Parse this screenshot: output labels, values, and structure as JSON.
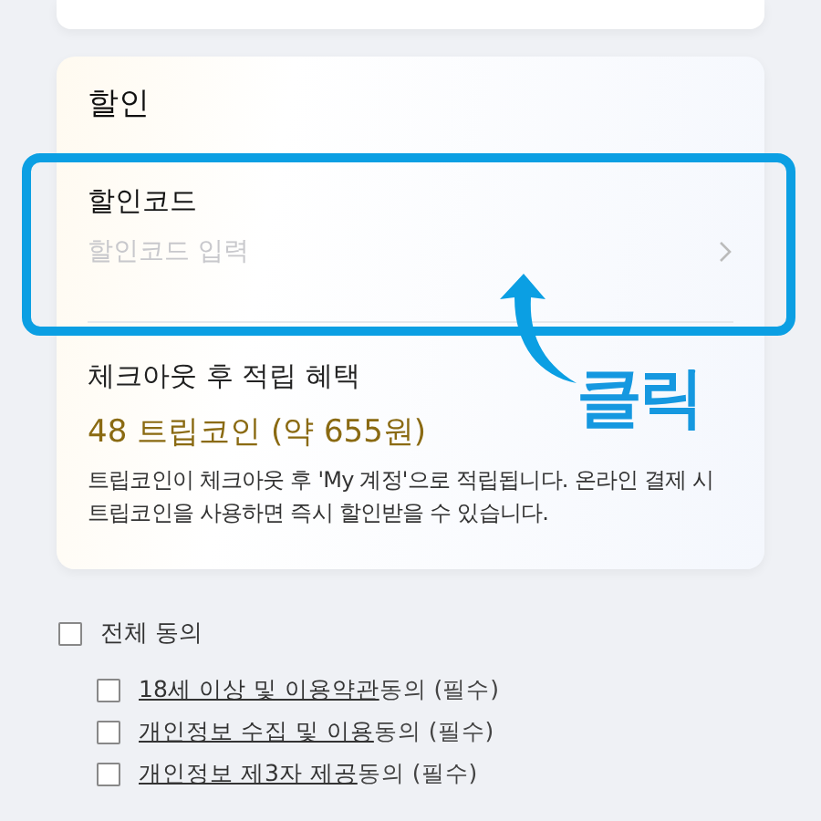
{
  "discount": {
    "title": "할인",
    "code_label": "할인코드",
    "code_placeholder": "할인코드 입력",
    "reward_title": "체크아웃 후 적립 혜택",
    "reward_amount": "48 트립코인 (약 655원)",
    "reward_description": "트립코인이 체크아웃 후 'My 계정'으로 적립됩니다. 온라인 결제 시 트립코인을 사용하면 즉시 할인받을 수 있습니다."
  },
  "annotation": {
    "label": "클릭"
  },
  "agreement": {
    "label": "전체 동의",
    "checked": false,
    "items": [
      {
        "link": "18세 이상 및 이용약관",
        "text": "동의 (필수)",
        "checked": false
      },
      {
        "link": "개인정보 수집 및 이용",
        "text": "동의 (필수)",
        "checked": false
      },
      {
        "link": "개인정보 제3자 제공",
        "text": "동의 (필수)",
        "checked": false
      }
    ]
  }
}
